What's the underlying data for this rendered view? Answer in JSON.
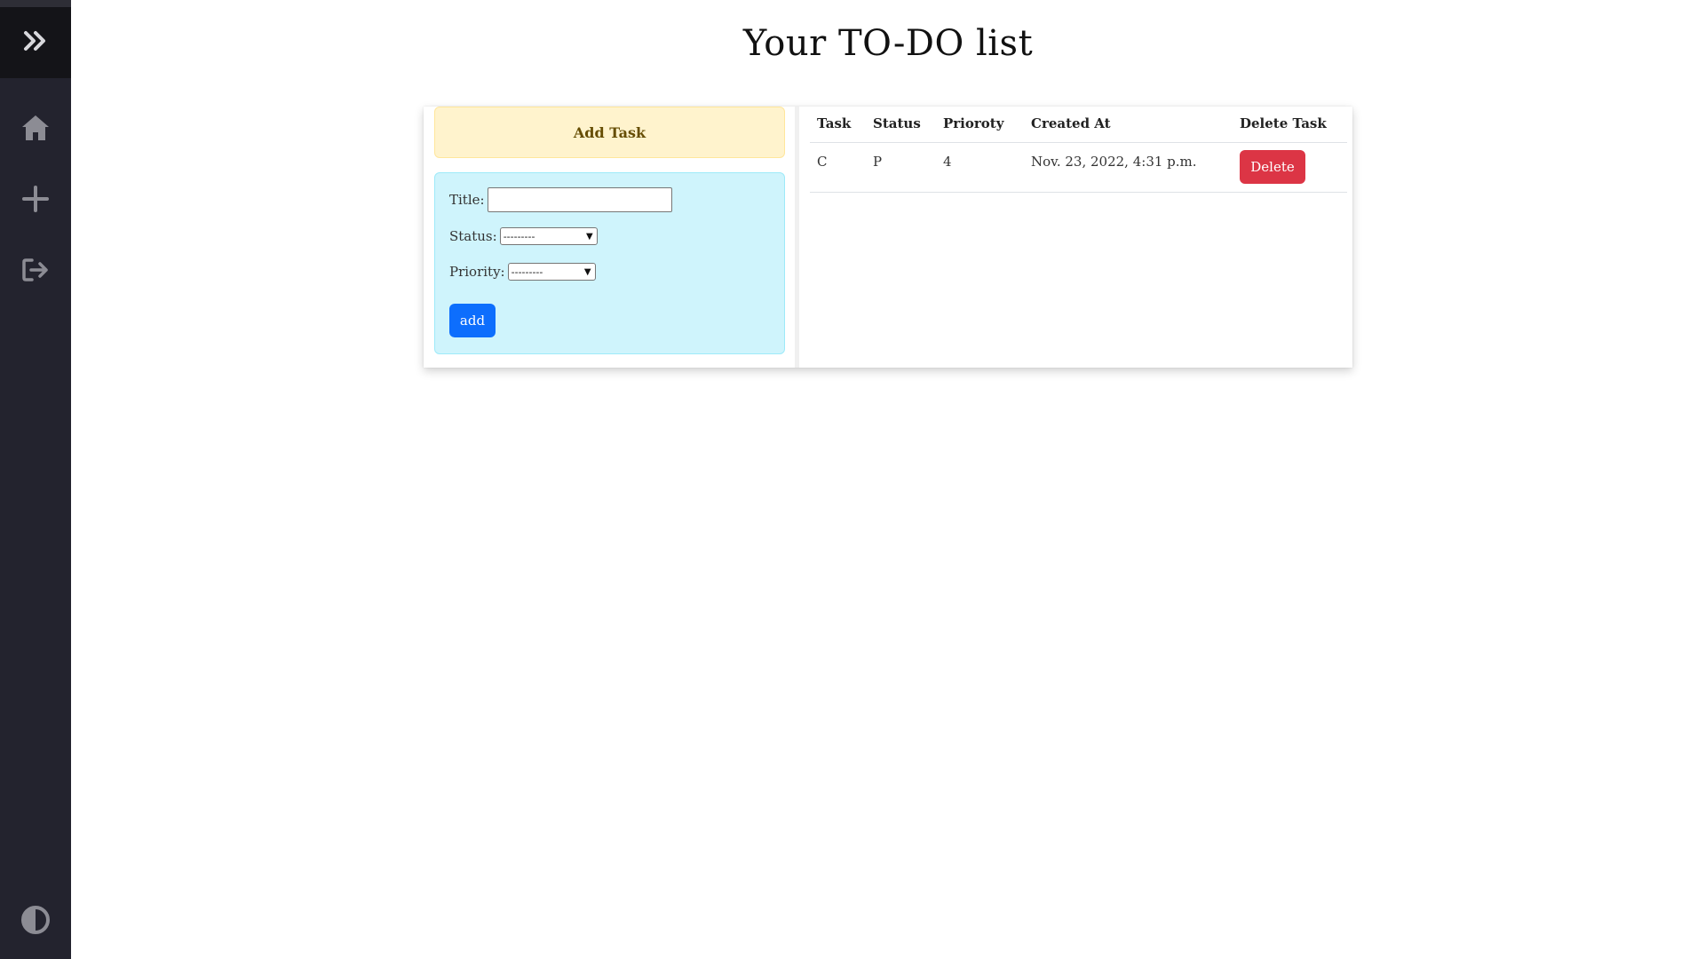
{
  "sidebar": {
    "items": [
      {
        "icon": "double-chevron-right-icon"
      },
      {
        "icon": "home-icon"
      },
      {
        "icon": "plus-icon"
      },
      {
        "icon": "logout-icon"
      },
      {
        "icon": "contrast-icon"
      }
    ]
  },
  "page": {
    "title": "Your TO-DO list"
  },
  "add_task": {
    "header": "Add Task",
    "title_label": "Title:",
    "title_value": "",
    "status_label": "Status:",
    "status_selected": "---------",
    "priority_label": "Priority:",
    "priority_selected": "---------",
    "add_label": "add"
  },
  "table": {
    "headers": [
      "Task",
      "Status",
      "Prioroty",
      "Created At",
      "Delete Task"
    ],
    "rows": [
      {
        "task": "C",
        "status": "P",
        "priority": "4",
        "created_at": "Nov. 23, 2022, 4:31 p.m.",
        "delete_label": "Delete"
      }
    ]
  },
  "colors": {
    "sidebar_bg": "#23232e",
    "header_bg": "#fff3cd",
    "form_bg": "#cff4fc",
    "add_button": "#0d6efd",
    "delete_button": "#dc3545"
  }
}
